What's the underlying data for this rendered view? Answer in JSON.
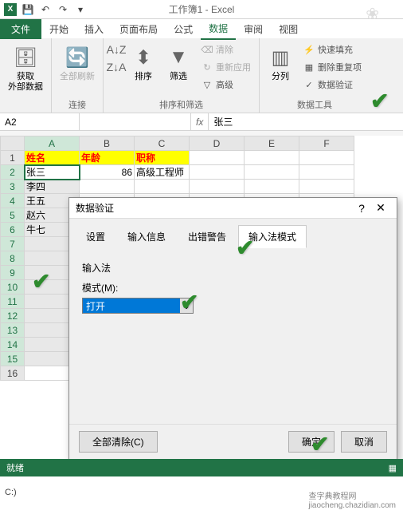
{
  "window": {
    "title": "工作簿1 - Excel"
  },
  "tabs": {
    "file": "文件",
    "home": "开始",
    "insert": "插入",
    "layout": "页面布局",
    "formulas": "公式",
    "data": "数据",
    "review": "审阅",
    "view": "视图"
  },
  "ribbon": {
    "external_data": "获取\n外部数据",
    "refresh_all": "全部刷新",
    "connections_group": "连接",
    "sort": "排序",
    "filter": "筛选",
    "clear": "清除",
    "reapply": "重新应用",
    "advanced": "高级",
    "sort_filter_group": "排序和筛选",
    "text_to_columns": "分列",
    "flash_fill": "快速填充",
    "remove_duplicates": "删除重复项",
    "data_validation": "数据验证",
    "data_tools_group": "数据工具"
  },
  "namebox": {
    "value": "A2"
  },
  "formula_bar": {
    "fx": "fx",
    "value": "张三"
  },
  "grid": {
    "cols": [
      "A",
      "B",
      "C",
      "D",
      "E",
      "F"
    ],
    "rows": [
      "1",
      "2",
      "3",
      "4",
      "5",
      "6",
      "7",
      "8",
      "9",
      "10",
      "11",
      "12",
      "13",
      "14",
      "15",
      "16"
    ],
    "headers": {
      "name": "姓名",
      "age": "年龄",
      "title": "职称"
    },
    "data": [
      {
        "name": "张三",
        "age": "86",
        "title": "高级工程师"
      },
      {
        "name": "李四",
        "age": "",
        "title": ""
      },
      {
        "name": "王五",
        "age": "",
        "title": ""
      },
      {
        "name": "赵六",
        "age": "",
        "title": ""
      },
      {
        "name": "牛七",
        "age": "",
        "title": ""
      }
    ]
  },
  "dialog": {
    "title": "数据验证",
    "tabs": {
      "settings": "设置",
      "input_msg": "输入信息",
      "error_alert": "出错警告",
      "ime_mode": "输入法模式"
    },
    "ime_label": "输入法",
    "mode_label": "模式(M):",
    "mode_value": "打开",
    "clear_all": "全部清除(C)",
    "ok": "确定",
    "cancel": "取消"
  },
  "status": {
    "ready": "就绪"
  },
  "bottom": {
    "drive": "C:)"
  },
  "watermark": "查字典教程网\njiaocheng.chazidian.com"
}
